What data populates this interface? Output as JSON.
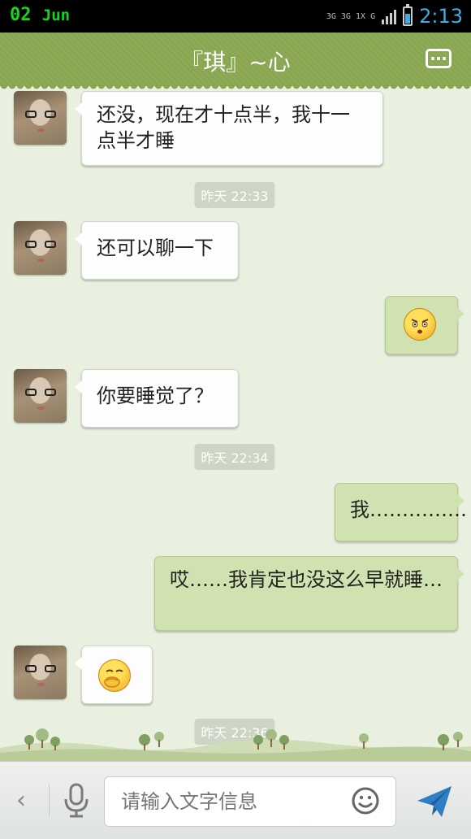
{
  "status_bar": {
    "date_day": "02",
    "date_month": "Jun",
    "network_1": "3G",
    "network_2": "3G",
    "network_3": "1X",
    "network_4": "G",
    "time": "2:13",
    "battery_level": 0.6
  },
  "header": {
    "title": "『琪』~心",
    "menu_icon": "more-dots-icon"
  },
  "messages": [
    {
      "side": "left",
      "text": "还没，现在才十点半，我十一点半才睡"
    },
    {
      "type": "timestamp",
      "text": "昨天 22:33"
    },
    {
      "side": "left",
      "text": "还可以聊一下"
    },
    {
      "side": "right",
      "emoji": "angry-face-emoji"
    },
    {
      "side": "left",
      "text": "你要睡觉了？"
    },
    {
      "type": "timestamp",
      "text": "昨天 22:34"
    },
    {
      "side": "right",
      "text": "我……………"
    },
    {
      "side": "right",
      "text": "哎……我肯定也没这么早就睡…"
    },
    {
      "side": "left",
      "emoji": "yawn-face-emoji"
    },
    {
      "type": "timestamp",
      "text": "昨天 22:36"
    }
  ],
  "input_bar": {
    "placeholder": "请输入文字信息",
    "back_icon": "chevron-left-icon",
    "mic_icon": "microphone-icon",
    "emoji_icon": "smiley-icon",
    "send_icon": "send-icon"
  },
  "colors": {
    "header_green": "#88a650",
    "chat_bg": "#e9f0df",
    "bubble_right": "#cfe2b0",
    "bubble_left": "#fdfdfd",
    "time_blue": "#3ab0e2"
  }
}
